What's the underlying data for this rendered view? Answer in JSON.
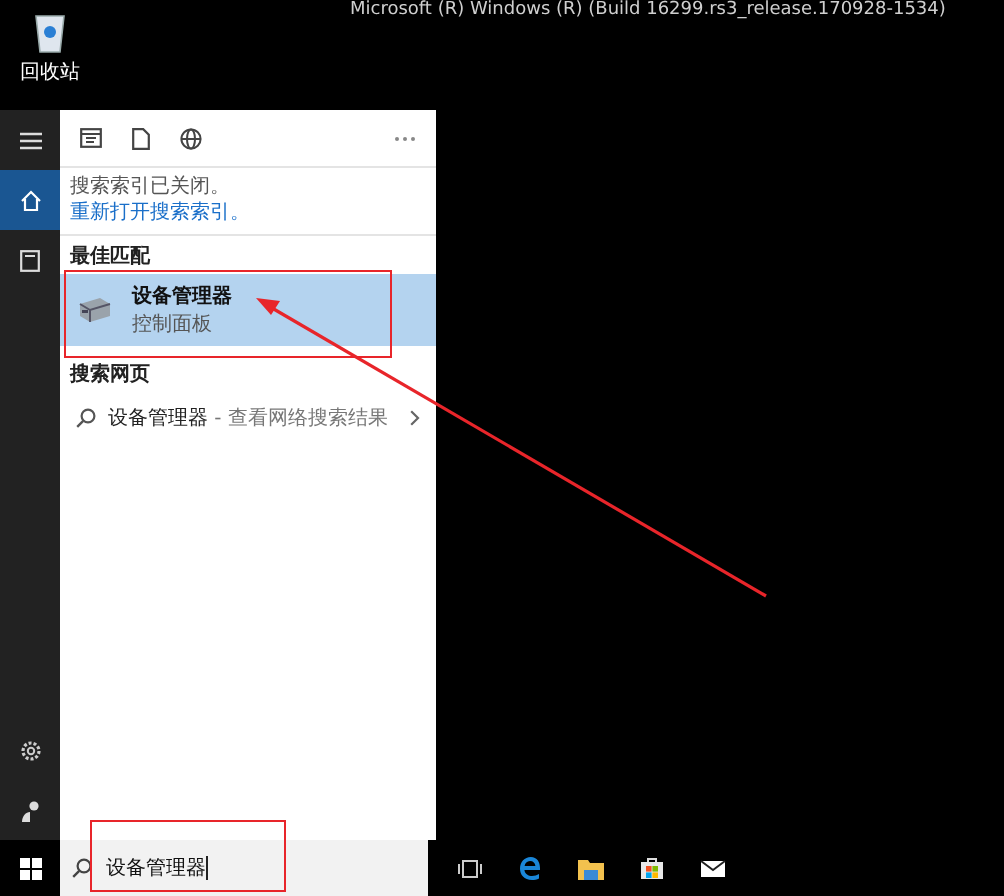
{
  "desktop": {
    "recycle_bin_label": "回收站",
    "build_text": "Microsoft (R) Windows (R) (Build 16299.rs3_release.170928-1534)"
  },
  "start_menu": {
    "rail_top": [
      {
        "kind": "menu",
        "selected": false
      },
      {
        "kind": "home",
        "selected": true
      },
      {
        "kind": "documents",
        "selected": false
      }
    ],
    "rail_bottom": [
      {
        "kind": "settings",
        "selected": false
      },
      {
        "kind": "user",
        "selected": false
      }
    ],
    "filters": [
      {
        "kind": "apps"
      },
      {
        "kind": "documents"
      },
      {
        "kind": "web"
      }
    ],
    "notice": "搜索索引已关闭。",
    "notice_link": "重新打开搜索索引。",
    "best_match_heading": "最佳匹配",
    "best_match": {
      "title": "设备管理器",
      "subtitle": "控制面板",
      "selected": true
    },
    "web_heading": "搜索网页",
    "web_result": {
      "query": "设备管理器",
      "hint": " - 查看网络搜索结果"
    }
  },
  "taskbar": {
    "search_value": "设备管理器",
    "apps": [
      {
        "kind": "task-view"
      },
      {
        "kind": "edge"
      },
      {
        "kind": "explorer"
      },
      {
        "kind": "store"
      },
      {
        "kind": "mail"
      }
    ]
  }
}
